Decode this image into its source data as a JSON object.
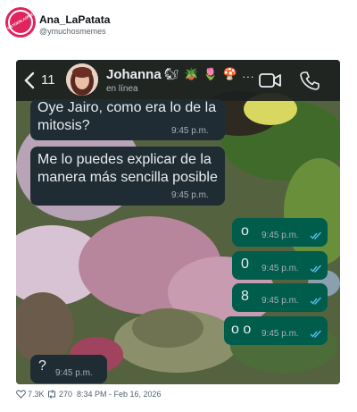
{
  "tweet": {
    "author_name": "Ana_LaPatata",
    "author_handle": "@ymuchosmemes",
    "avatar_text": "VISTOENLASREDES.COM",
    "likes": "7.3K",
    "retweets": "270",
    "timestamp": "8:34 PM - Feb 16, 2026"
  },
  "chat": {
    "back_count": "11",
    "contact_name": "Johanna",
    "contact_emojis": "🐿 🪴 🌷 🍄 ...",
    "contact_status": "en línea",
    "messages": [
      {
        "direction": "in",
        "text_line1": "Oye Jairo, como era lo de la",
        "text_line2": "mitosis?",
        "time": "9:45 p.m."
      },
      {
        "direction": "in",
        "text_line1": "Me lo puedes explicar de la",
        "text_line2": "manera más sencilla posible",
        "time": "9:45 p.m."
      },
      {
        "direction": "out",
        "text": "o",
        "time": "9:45 p.m."
      },
      {
        "direction": "out",
        "text": "0",
        "time": "9:45 p.m."
      },
      {
        "direction": "out",
        "text": "8",
        "time": "9:45 p.m."
      },
      {
        "direction": "out",
        "text": "o o",
        "time": "9:45 p.m."
      },
      {
        "direction": "in",
        "text": "?",
        "time": "9:45 p.m."
      }
    ]
  },
  "colors": {
    "incoming_bubble": "#1f2c34",
    "outgoing_bubble": "#005c4b",
    "read_ticks": "#53bdeb",
    "header": "#1d1f20"
  },
  "icons": [
    "back-arrow-icon",
    "video-call-icon",
    "phone-call-icon",
    "read-ticks-icon",
    "heart-icon",
    "retweet-icon"
  ]
}
